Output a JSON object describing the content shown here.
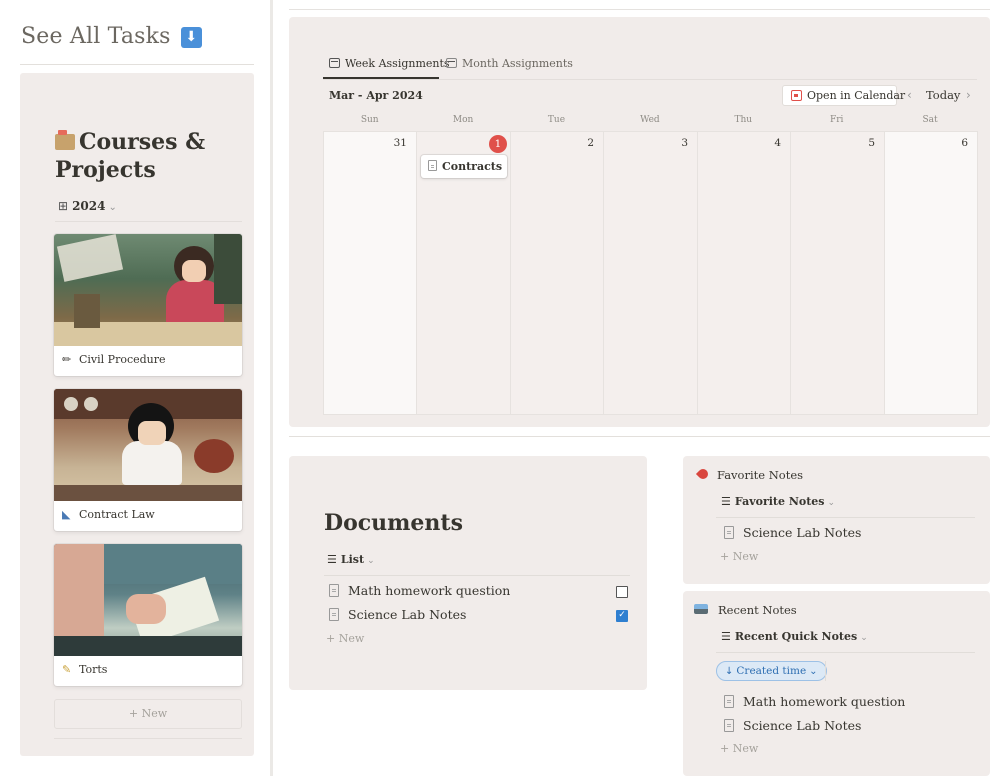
{
  "sidebar": {
    "see_all": "See All Tasks",
    "see_all_icon": "down-arrow-box-icon",
    "section_title": "Courses & Projects",
    "year_filter": "2024",
    "cards": [
      {
        "label": "Civil Procedure",
        "icon": "pencil-icon"
      },
      {
        "label": "Contract Law",
        "icon": "triangle-ruler-icon"
      },
      {
        "label": "Torts",
        "icon": "memo-icon"
      }
    ],
    "new_label": "+ New"
  },
  "calendar": {
    "tabs": [
      "Week Assignments",
      "Month Assignments"
    ],
    "range": "Mar - Apr 2024",
    "open_btn": "Open in Calendar",
    "today_btn": "Today",
    "days": [
      "Sun",
      "Mon",
      "Tue",
      "Wed",
      "Thu",
      "Fri",
      "Sat"
    ],
    "dates": [
      "31",
      "1",
      "2",
      "3",
      "4",
      "5",
      "6"
    ],
    "today_index": 1,
    "event": {
      "title": "Contracts",
      "day_index": 1
    }
  },
  "documents": {
    "title": "Documents",
    "view": "List",
    "rows": [
      {
        "title": "Math homework question",
        "checked": false
      },
      {
        "title": "Science Lab Notes",
        "checked": true
      }
    ],
    "new_label": "+ New"
  },
  "favorites": {
    "heading": "Favorite Notes",
    "view": "Favorite Notes",
    "rows": [
      "Science Lab Notes"
    ],
    "new_label": "+ New"
  },
  "recent": {
    "heading": "Recent Notes",
    "view": "Recent Quick Notes",
    "sort_chip": "Created time",
    "rows": [
      "Math homework question",
      "Science Lab Notes"
    ],
    "new_label": "+ New"
  },
  "colors": {
    "panel_bg": "#f1ecea",
    "today_red": "#e0504a",
    "checkbox_blue": "#2f7fd0",
    "chip_blue": "#2f6fb2"
  }
}
